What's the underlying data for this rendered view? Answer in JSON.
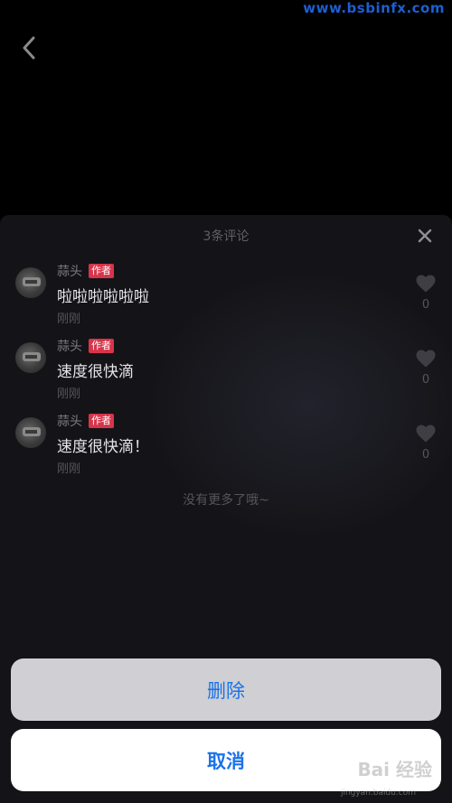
{
  "watermark": {
    "top_text": "www.bsbinfx.com",
    "baidu_text": "Bai 经验",
    "baidu_sub": "jingyan.baidu.com"
  },
  "sheet": {
    "title": "3条评论"
  },
  "comments": [
    {
      "username": "蒜头",
      "badge": "作者",
      "text": "啦啦啦啦啦啦",
      "time": "刚刚",
      "likes": "0"
    },
    {
      "username": "蒜头",
      "badge": "作者",
      "text": "速度很快滴",
      "time": "刚刚",
      "likes": "0"
    },
    {
      "username": "蒜头",
      "badge": "作者",
      "text": "速度很快滴！",
      "time": "刚刚",
      "likes": "0"
    }
  ],
  "end_message": "没有更多了哦~",
  "actions": {
    "delete_label": "删除",
    "cancel_label": "取消"
  },
  "icons": {
    "back": "chevron-left-icon",
    "close": "close-icon",
    "like": "heart-icon"
  },
  "colors": {
    "accent": "#1a73e8",
    "badge": "#d8344a",
    "sheet_bg": "#141418"
  }
}
